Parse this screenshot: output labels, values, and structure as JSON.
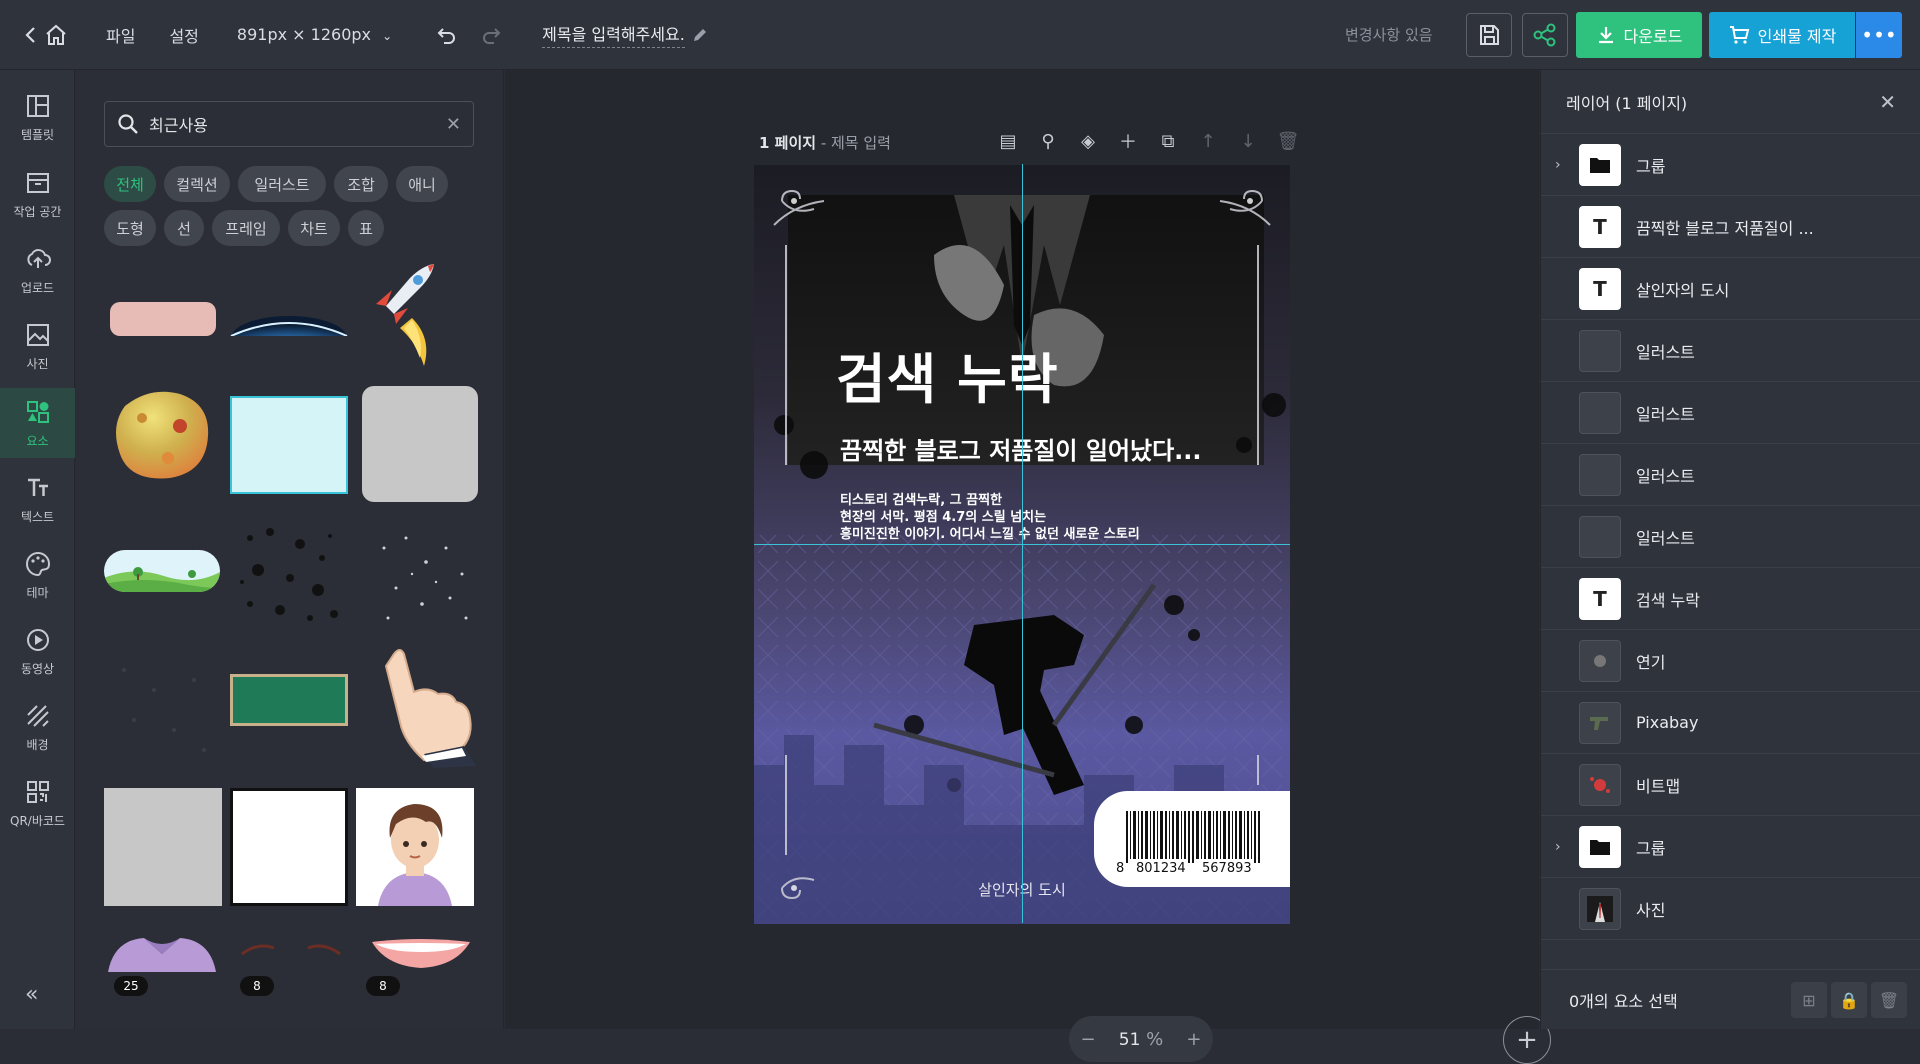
{
  "topbar": {
    "menu_file": "파일",
    "menu_settings": "설정",
    "canvas_size": "891px × 1260px",
    "doc_title": "제목을 입력해주세요.",
    "changes_status": "변경사항 있음",
    "download_label": "다운로드",
    "print_label": "인쇄물 제작"
  },
  "iconbar": {
    "items": [
      {
        "label": "템플릿",
        "icon": "template-icon"
      },
      {
        "label": "작업 공간",
        "icon": "workspace-icon"
      },
      {
        "label": "업로드",
        "icon": "upload-icon"
      },
      {
        "label": "사진",
        "icon": "photo-icon"
      },
      {
        "label": "요소",
        "icon": "elements-icon"
      },
      {
        "label": "텍스트",
        "icon": "text-icon"
      },
      {
        "label": "테마",
        "icon": "palette-icon"
      },
      {
        "label": "동영상",
        "icon": "video-icon"
      },
      {
        "label": "배경",
        "icon": "background-icon"
      },
      {
        "label": "QR/바코드",
        "icon": "qr-icon"
      }
    ],
    "active": "요소",
    "collapse_label": "«"
  },
  "panel": {
    "search_value": "최근사용",
    "chips": [
      "전체",
      "컬렉션",
      "일러스트",
      "조합",
      "애니",
      "도형",
      "선",
      "프레임",
      "차트",
      "표"
    ],
    "active_chip": "전체",
    "badges": [
      "25",
      "8",
      "8"
    ]
  },
  "canvas": {
    "page_label": "1 페이지",
    "page_sub": " - 제목 입력",
    "zoom_value": "51",
    "zoom_unit": "%"
  },
  "poster": {
    "title": "검색 누락",
    "subtitle": "끔찍한 블로그 저품질이 일어났다...",
    "body_lines": [
      "티스토리 검색누락, 그 끔찍한",
      "현장의 서막. 평점 4.7의 스릴 넘치는",
      "흥미진진한 이야기. 어디서 느낄 수 없던 새로운 스토리"
    ],
    "footer": "살인자의 도시",
    "barcode_digits": [
      "8",
      "801234",
      "567893"
    ]
  },
  "layers": {
    "header": "레이어 (1 페이지)",
    "items": [
      {
        "name": "그룹",
        "kind": "folder"
      },
      {
        "name": "끔찍한 블로그 저품질이 ...",
        "kind": "text"
      },
      {
        "name": "살인자의 도시",
        "kind": "text"
      },
      {
        "name": "일러스트",
        "kind": "illust"
      },
      {
        "name": "일러스트",
        "kind": "illust"
      },
      {
        "name": "일러스트",
        "kind": "illust"
      },
      {
        "name": "일러스트",
        "kind": "illust"
      },
      {
        "name": "검색 누락",
        "kind": "text"
      },
      {
        "name": "연기",
        "kind": "illust"
      },
      {
        "name": "Pixabay",
        "kind": "illust"
      },
      {
        "name": "비트맵",
        "kind": "illust"
      },
      {
        "name": "그룹",
        "kind": "folder"
      },
      {
        "name": "사진",
        "kind": "illust"
      }
    ],
    "footer": "0개의 요소 선택"
  }
}
